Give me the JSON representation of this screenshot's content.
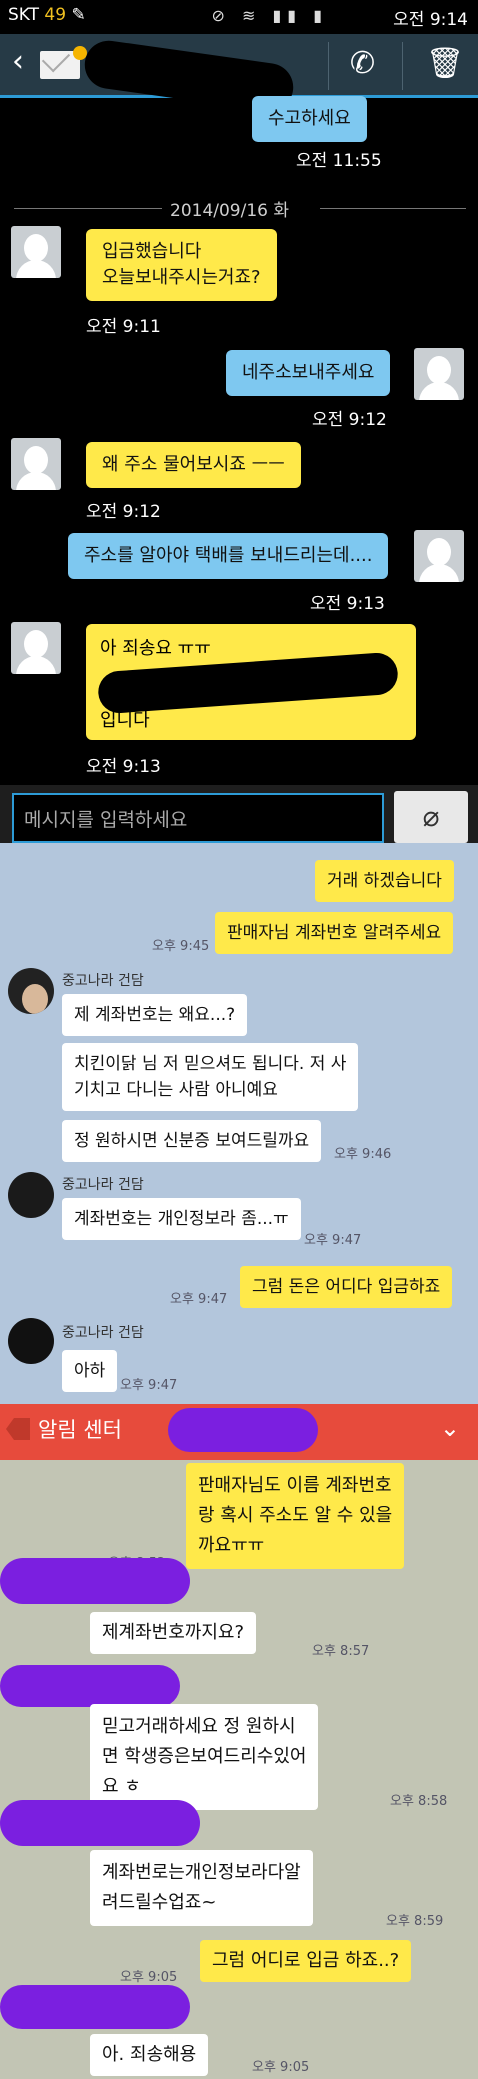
{
  "status_bar": {
    "carrier": "SKT",
    "battery_level": "49",
    "clock": "오전 9:14"
  },
  "sms": {
    "messages": [
      {
        "text": "수고하세요",
        "time": "오전 11:55"
      },
      {
        "text": "입금했습니다\n오늘보내주시는거죠?",
        "time": "오전 9:11"
      },
      {
        "text": "네주소보내주세요",
        "time": "오전 9:12"
      },
      {
        "text": "왜 주소 물어보시죠 ㅡㅡ",
        "time": "오전 9:12"
      },
      {
        "text": "주소를 알아야 택배를 보내드리는데....",
        "time": "오전 9:13"
      },
      {
        "text_top": "아 죄송요 ㅠㅠ",
        "text_bottom": "입니다",
        "time": "오전 9:13"
      }
    ],
    "date_separator": "2014/09/16 화",
    "input_placeholder": "메시지를 입력하세요"
  },
  "kakao1": {
    "sender_name": "중고나라 건담",
    "messages": [
      {
        "text": "거래 하겠습니다"
      },
      {
        "text": "판매자님 계좌번호 알려주세요",
        "time": "오후 9:45"
      },
      {
        "text": "제 계좌번호는 왜요...?"
      },
      {
        "text": "치킨이닭 님 저 믿으셔도 됩니다. 저 사\n기치고 다니는 사람 아니예요"
      },
      {
        "text": "정 원하시면 신분증 보여드릴까요",
        "time": "오후 9:46"
      },
      {
        "text": "계좌번호는 개인정보라 좀...ㅠ",
        "time": "오후 9:47"
      },
      {
        "text": "그럼 돈은 어디다 입금하죠",
        "time": "오후 9:47"
      },
      {
        "text": "아하",
        "time": "오후 9:47"
      }
    ]
  },
  "kakao2": {
    "alarm_center": "알림 센터",
    "messages": [
      {
        "text": "판매자님도 이름 계좌번호\n랑 혹시 주소도 알 수 있을\n까요ㅠㅠ",
        "time": "오후 8:52"
      },
      {
        "text": "제계좌번호까지요?",
        "time": "오후 8:57"
      },
      {
        "text": "믿고거래하세요 정 원하시\n면 학생증은보여드리수있어\n요 ㅎ",
        "time": "오후 8:58"
      },
      {
        "text": "계좌번로는개인정보라다알\n려드릴수업죠~",
        "time": "오후 8:59"
      },
      {
        "text": "그럼 어디로 입금 하죠..?",
        "time": "오후 9:05"
      },
      {
        "text": "아. 죄송해용",
        "time": "오후 9:05"
      }
    ]
  },
  "colors": {
    "sms_blue": "#7ec8f0",
    "kakao_yellow": "#ffe94a",
    "alarm_red": "#e74b3c",
    "redaction_purple": "#7b1fe0"
  }
}
